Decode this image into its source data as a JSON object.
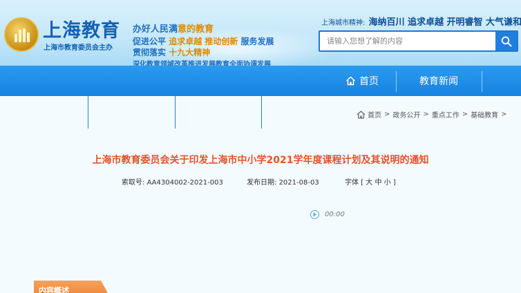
{
  "header": {
    "logo_title": "上海教育",
    "logo_sub": "上海市教育委员会主办",
    "slogan1_a": "办好人民满",
    "slogan1_b": "意的教育",
    "slogan2_a": "促进公平 ",
    "slogan2_b": "追求卓越 推动创新",
    "slogan2_c": " 服务发展",
    "slogan3_a": "贯彻落实",
    "slogan3_b": "十九大精神",
    "slogan4": "深化教育领域改革推进发展教育全面协调发展",
    "spirit_label": "上海城市精神:",
    "spirit_value": "海纳百川 追求卓越 开明睿智 大气谦和"
  },
  "search": {
    "placeholder": "请输入您想了解的内容"
  },
  "nav": {
    "home": "首页",
    "news": "教育新闻"
  },
  "breadcrumb": {
    "items": [
      "首页",
      "政务公开",
      "重点工作",
      "基础教育"
    ],
    "sep": ">"
  },
  "document": {
    "title": "上海市教育委员会关于印发上海市中小学2021学年度课程计划及其说明的通知",
    "index_label": "索取号:",
    "index_value": "AA4304002-2021-003",
    "date_label": "发布日期:",
    "date_value": "2021-08-03",
    "font_label": "字体",
    "font_open": "[",
    "font_large": "大",
    "font_medium": "中",
    "font_small": "小",
    "font_close": "]"
  },
  "audio": {
    "time": "00:00"
  },
  "summary_tab": "内容概述",
  "colors": {
    "nav_blue": "#1683e0",
    "title_orange": "#e0542b",
    "brand_blue": "#1561b2"
  },
  "icons": [
    "emblem-icon",
    "search-icon",
    "home-icon",
    "play-icon"
  ]
}
